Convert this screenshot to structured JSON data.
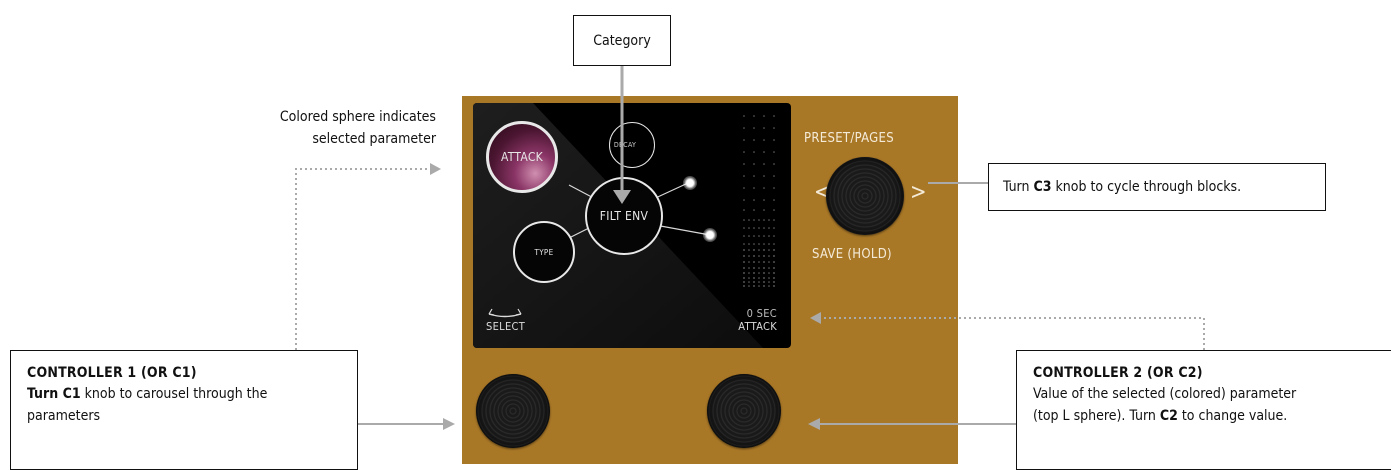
{
  "callouts": {
    "category": "Category",
    "sphere_hint_line1": "Colored sphere indicates",
    "sphere_hint_line2": "selected parameter",
    "c3_pre": "Turn ",
    "c3_bold": "C3",
    "c3_post": " knob to cycle through blocks.",
    "c1_title": "CONTROLLER 1 (OR C1)",
    "c1_bold": "Turn C1",
    "c1_line1_post": " knob to carousel through the",
    "c1_line2": "parameters",
    "c2_title": "CONTROLLER 2 (OR C2)",
    "c2_line1": "Value of the selected (colored) parameter",
    "c2_line2_pre": "(top L sphere). Turn ",
    "c2_bold": "C2",
    "c2_line2_post": " to change value."
  },
  "screen": {
    "attack": "ATTACK",
    "decay": "DECAY",
    "filt_env": "FILT ENV",
    "type": "TYPE",
    "select": "SELECT",
    "value": "0 SEC",
    "param": "ATTACK"
  },
  "device": {
    "preset_pages": "PRESET/PAGES",
    "save_hold": "SAVE (HOLD)",
    "prev": "<",
    "next": ">"
  },
  "colors": {
    "device": "#a97827",
    "screen": "#000000",
    "selected_sphere": "#7a2a5a",
    "arrow": "#aaaaaa"
  }
}
